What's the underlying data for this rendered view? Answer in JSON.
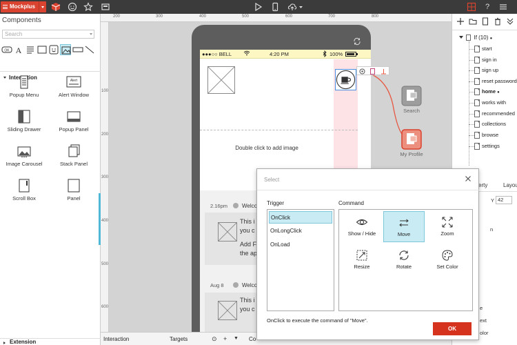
{
  "app": {
    "brand": "Mockplus",
    "colors": {
      "accent": "#d9432f",
      "selection": "#c9ebf4",
      "toolbar": "#3b3b3b",
      "ok": "#d6331f"
    },
    "toolbar_icons": [
      "box-icon",
      "smiley-icon",
      "star-icon",
      "screenshot-icon",
      "play-icon",
      "mobile-icon",
      "cloud-upload-icon",
      "grid-icon",
      "help-icon",
      "menu-icon"
    ]
  },
  "components": {
    "title": "Components",
    "search_placeholder": "Search",
    "section": "Interaction",
    "items": [
      {
        "label": "Popup Menu",
        "icon": "popup-menu-icon"
      },
      {
        "label": "Alert Window",
        "icon": "alert-window-icon",
        "icon_text": "Alert"
      },
      {
        "label": "Sliding Drawer",
        "icon": "sliding-drawer-icon"
      },
      {
        "label": "Popup Panel",
        "icon": "popup-panel-icon"
      },
      {
        "label": "Image Carousel",
        "icon": "image-carousel-icon"
      },
      {
        "label": "Stack Panel",
        "icon": "stack-panel-icon"
      },
      {
        "label": "Scroll Box",
        "icon": "scroll-box-icon"
      },
      {
        "label": "Panel",
        "icon": "panel-icon"
      }
    ],
    "shape_tools": [
      "ok-icon",
      "text-icon",
      "font-icon",
      "rectangle-icon",
      "smiley-icon",
      "image-icon",
      "rect-wide-icon",
      "line-icon"
    ],
    "shape_ok": "OK",
    "shape_a": "A",
    "extension": "Extension"
  },
  "rulers": {
    "top": [
      "200",
      "300",
      "400",
      "500",
      "600",
      "700",
      "800"
    ],
    "left": [
      "100",
      "200",
      "300",
      "400",
      "500",
      "600"
    ]
  },
  "phone": {
    "carrier": "●●●○○ BELL",
    "time": "4:20 PM",
    "battery": "100%",
    "add_image": "Double click to add image",
    "messages": [
      {
        "time": "2.16pm",
        "welcome": "Welco",
        "line1": "This i",
        "line2": "you c",
        "line3": "Add F",
        "line4": "the ap"
      },
      {
        "time": "Aug 8",
        "welcome": "Welco",
        "line1": "This i",
        "line2": "you c"
      }
    ]
  },
  "page_nodes": [
    {
      "label": "Search"
    },
    {
      "label": "My Profile"
    }
  ],
  "pages": {
    "root": "If (10)",
    "root_marker": "●",
    "items": [
      "start",
      "sign in",
      "sign up",
      "reset password",
      "home",
      "works with",
      "recommended",
      "collections",
      "browse",
      "settings"
    ],
    "active": "home",
    "active_marker": "●"
  },
  "properties": {
    "tab1": "erty",
    "tab2": "Layou",
    "y_label": "Y",
    "y_value": "42",
    "frag1": "n",
    "frag2": "e",
    "frag3": "ext",
    "frag4": "olor"
  },
  "bottom": {
    "interaction": "Interaction",
    "targets": "Targets",
    "co": "Co"
  },
  "dialog": {
    "title": "Select",
    "trigger_label": "Trigger",
    "command_label": "Command",
    "triggers": [
      "OnClick",
      "OnLongClick",
      "OnLoad"
    ],
    "selected_trigger": "OnClick",
    "commands": [
      {
        "label": "Show / Hide",
        "icon": "eye-icon"
      },
      {
        "label": "Move",
        "icon": "move-icon"
      },
      {
        "label": "Zoom",
        "icon": "zoom-icon"
      },
      {
        "label": "Resize",
        "icon": "resize-icon"
      },
      {
        "label": "Rotate",
        "icon": "rotate-icon"
      },
      {
        "label": "Set Color",
        "icon": "palette-icon"
      }
    ],
    "selected_command": "Move",
    "status": "OnClick to execute the command of \"Move\".",
    "ok": "OK"
  }
}
